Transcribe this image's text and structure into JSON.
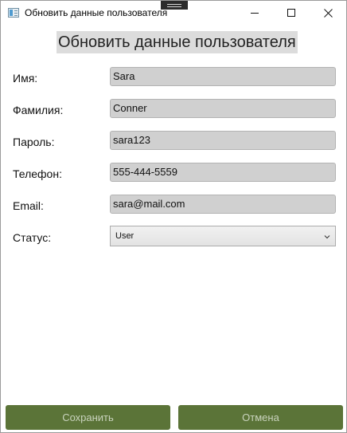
{
  "window": {
    "title": "Обновить данные пользователя",
    "icon": "app-window-icon",
    "controls": [
      "minimize-icon",
      "maximize-icon",
      "close-icon"
    ]
  },
  "form": {
    "heading": "Обновить данные пользователя",
    "fields": [
      {
        "label": "Имя:",
        "value": "Sara"
      },
      {
        "label": "Фамилия:",
        "value": "Conner"
      },
      {
        "label": "Пароль:",
        "value": "sara123"
      },
      {
        "label": "Телефон:",
        "value": "555-444-5559"
      },
      {
        "label": "Email:",
        "value": "sara@mail.com"
      }
    ],
    "status": {
      "label": "Статус:",
      "selected": "User"
    }
  },
  "actions": {
    "save_label": "Сохранить",
    "cancel_label": "Отмена"
  },
  "colors": {
    "button_bg": "#5b7438",
    "button_text": "#c9d3bd",
    "input_bg": "#d0d0d0",
    "heading_bg": "#dcdcdc"
  }
}
